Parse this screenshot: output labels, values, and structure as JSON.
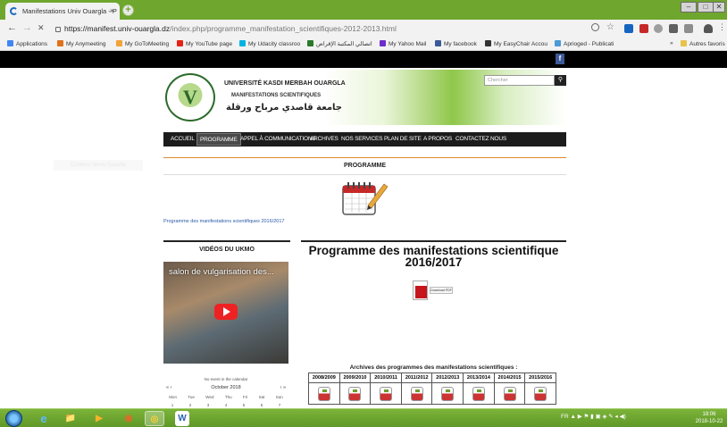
{
  "browser": {
    "tab_title": "Manifestations Univ Ouargla - P",
    "tab_close": "×",
    "new_tab": "+",
    "url_host": "https://manifest.univ-ouargla.dz",
    "url_path": "/index.php/programme_manifestation_scientifiques-2012-2013.html",
    "back": "←",
    "forward": "→",
    "stop": "✕",
    "window_buttons": [
      "–",
      "□",
      "✕"
    ],
    "bookmarks": [
      {
        "label": "Applications",
        "color": "#4285f4"
      },
      {
        "label": "My Anymeeting",
        "color": "#e0721c"
      },
      {
        "label": "My GoToMeeting",
        "color": "#f2a33a"
      },
      {
        "label": "My YouTube page",
        "color": "#e62117"
      },
      {
        "label": "My Udacity classroo",
        "color": "#02b3e4"
      },
      {
        "label": "اتصالي المكتبة الإقراض",
        "color": "#2a7a2a"
      },
      {
        "label": "My Yahoo Mail",
        "color": "#6e2dcb"
      },
      {
        "label": "My facebook",
        "color": "#3b5998"
      },
      {
        "label": "My EasyChair Accou",
        "color": "#333333"
      },
      {
        "label": "Aprioged - Publicati",
        "color": "#4c9ad6"
      }
    ],
    "bookmarks_more": "»",
    "bookmarks_other": "Autres favoris"
  },
  "site": {
    "university_name": "UNIVERSITÉ KASDI MERBAH OUARGLA",
    "subtitle": "MANIFESTATIONS SCIENTIFIQUES",
    "arabic_name": "جامعة قاصدي مرباح ورقلة",
    "search_placeholder": "Chercher",
    "search_button": "🔍",
    "facebook": "f",
    "menu": [
      "ACCUEIL",
      "PROGRAMME",
      "APPEL À COMMUNICATIONS",
      "ARCHIVES",
      "NOS SERVICES",
      "PLAN DE SITE",
      "A PROPOS",
      "CONTACTEZ NOUS"
    ],
    "active_menu": "PROGRAMME",
    "section_title": "PROGRAMME",
    "side_label": "Contenu Menu Gauche",
    "program_link": "Programme des manifestations scientifiques 2016/2017",
    "videos_header": "VIDÉOS DU UKMO",
    "video_title": "salon de vulgarisation des...",
    "calendar": {
      "no_event": "No event in the calendar",
      "prev": "«  ‹",
      "next": "›  »",
      "month": "October 2018",
      "days": [
        "Mon",
        "Tue",
        "Wed",
        "Thu",
        "Fri",
        "Sat",
        "Sun"
      ],
      "first_row": [
        "1",
        "2",
        "3",
        "4",
        "5",
        "6",
        "7"
      ]
    },
    "main_title": "Programme des manifestations scientifique 2016/2017",
    "pdf_label": "Download PDF",
    "archives_title": "Archives des programmes des manifestations scientifiques :",
    "archive_years": [
      "2008/2009",
      "2009/2010",
      "2010/2011",
      "2011/2012",
      "2012/2013",
      "2013/2014",
      "2014/2015",
      "2015/2016"
    ]
  },
  "taskbar": {
    "apps": [
      "e",
      "📁",
      "▶",
      "◉",
      "◎",
      "W"
    ],
    "tray": "FR  ▲  ▶ ⚑ ▮ ▣ ◈ ✎ ◂ ◀)",
    "time": "18:06",
    "date": "2018-10-22"
  },
  "colors": {
    "tab_bar": "#6fa62e",
    "menu_bg": "#1c1c1c",
    "accent_orange": "#e08a2c",
    "taskbar": "#5f9827"
  }
}
